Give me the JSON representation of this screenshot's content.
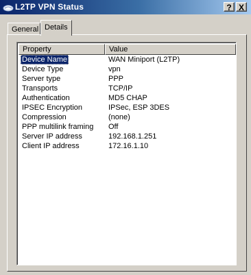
{
  "window": {
    "title": "L2TP VPN Status",
    "help_label": "?",
    "close_label": "X"
  },
  "tabs": [
    {
      "label": "General",
      "active": false
    },
    {
      "label": "Details",
      "active": true
    }
  ],
  "table": {
    "columns": [
      "Property",
      "Value"
    ],
    "rows": [
      {
        "property": "Device Name",
        "value": "WAN Miniport (L2TP)",
        "selected": true
      },
      {
        "property": "Device Type",
        "value": "vpn"
      },
      {
        "property": "Server type",
        "value": "PPP"
      },
      {
        "property": "Transports",
        "value": "TCP/IP"
      },
      {
        "property": "Authentication",
        "value": "MD5 CHAP"
      },
      {
        "property": "IPSEC Encryption",
        "value": "IPSec, ESP 3DES"
      },
      {
        "property": "Compression",
        "value": "(none)"
      },
      {
        "property": "PPP multilink framing",
        "value": "Off"
      },
      {
        "property": "Server IP address",
        "value": "192.168.1.251"
      },
      {
        "property": "Client IP address",
        "value": "172.16.1.10"
      }
    ]
  },
  "icons": {
    "title_icon": "network-connection-icon"
  },
  "colors": {
    "titlebar_start": "#0a246a",
    "titlebar_end": "#a6caf0",
    "selection": "#0a246a",
    "face": "#d4d0c8"
  }
}
